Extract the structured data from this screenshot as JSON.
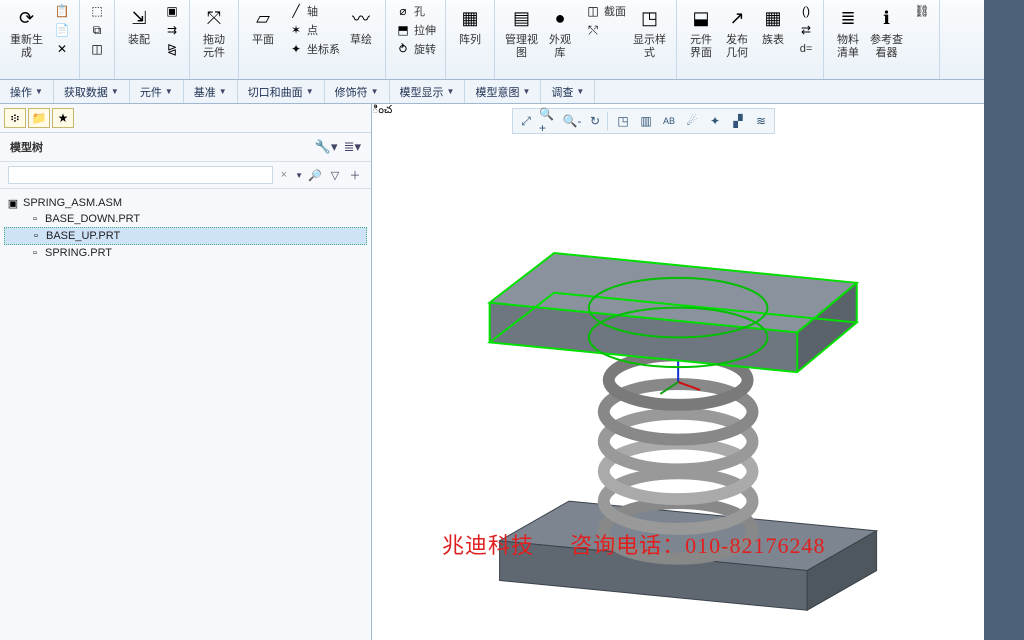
{
  "ribbon": {
    "regen": "重新生\n成",
    "fit": "装配",
    "drag": "拖动\n元件",
    "plane": "平面",
    "sketch": "草绘",
    "axis": "轴",
    "point": "点",
    "csys": "坐标系",
    "hole": "孔",
    "extrude": "拉伸",
    "revolve": "旋转",
    "pattern": "阵列",
    "viewmgr": "管理视\n图",
    "appear": "外观\n库",
    "section": "截面",
    "dispstyle": "显示样\n式",
    "compui": "元件\n界面",
    "pubgeom": "发布\n几何",
    "family": "族表",
    "params": "d=",
    "bom": "物料\n清单",
    "refview": "参考查\n看器"
  },
  "tabs": {
    "ops": "操作",
    "getdata": "获取数据",
    "comp": "元件",
    "datum": "基准",
    "cut": "切口和曲面",
    "modifier": "修饰符",
    "modeldisp": "模型显示",
    "intent": "模型意图",
    "investigate": "调查"
  },
  "sidebar": {
    "title": "模型树",
    "search_placeholder": ""
  },
  "tree": {
    "root": "SPRING_ASM.ASM",
    "items": [
      "BASE_DOWN.PRT",
      "BASE_UP.PRT",
      "SPRING.PRT"
    ]
  },
  "watermark": {
    "company": "兆迪科技",
    "contact": "咨询电话：010-82176248"
  }
}
